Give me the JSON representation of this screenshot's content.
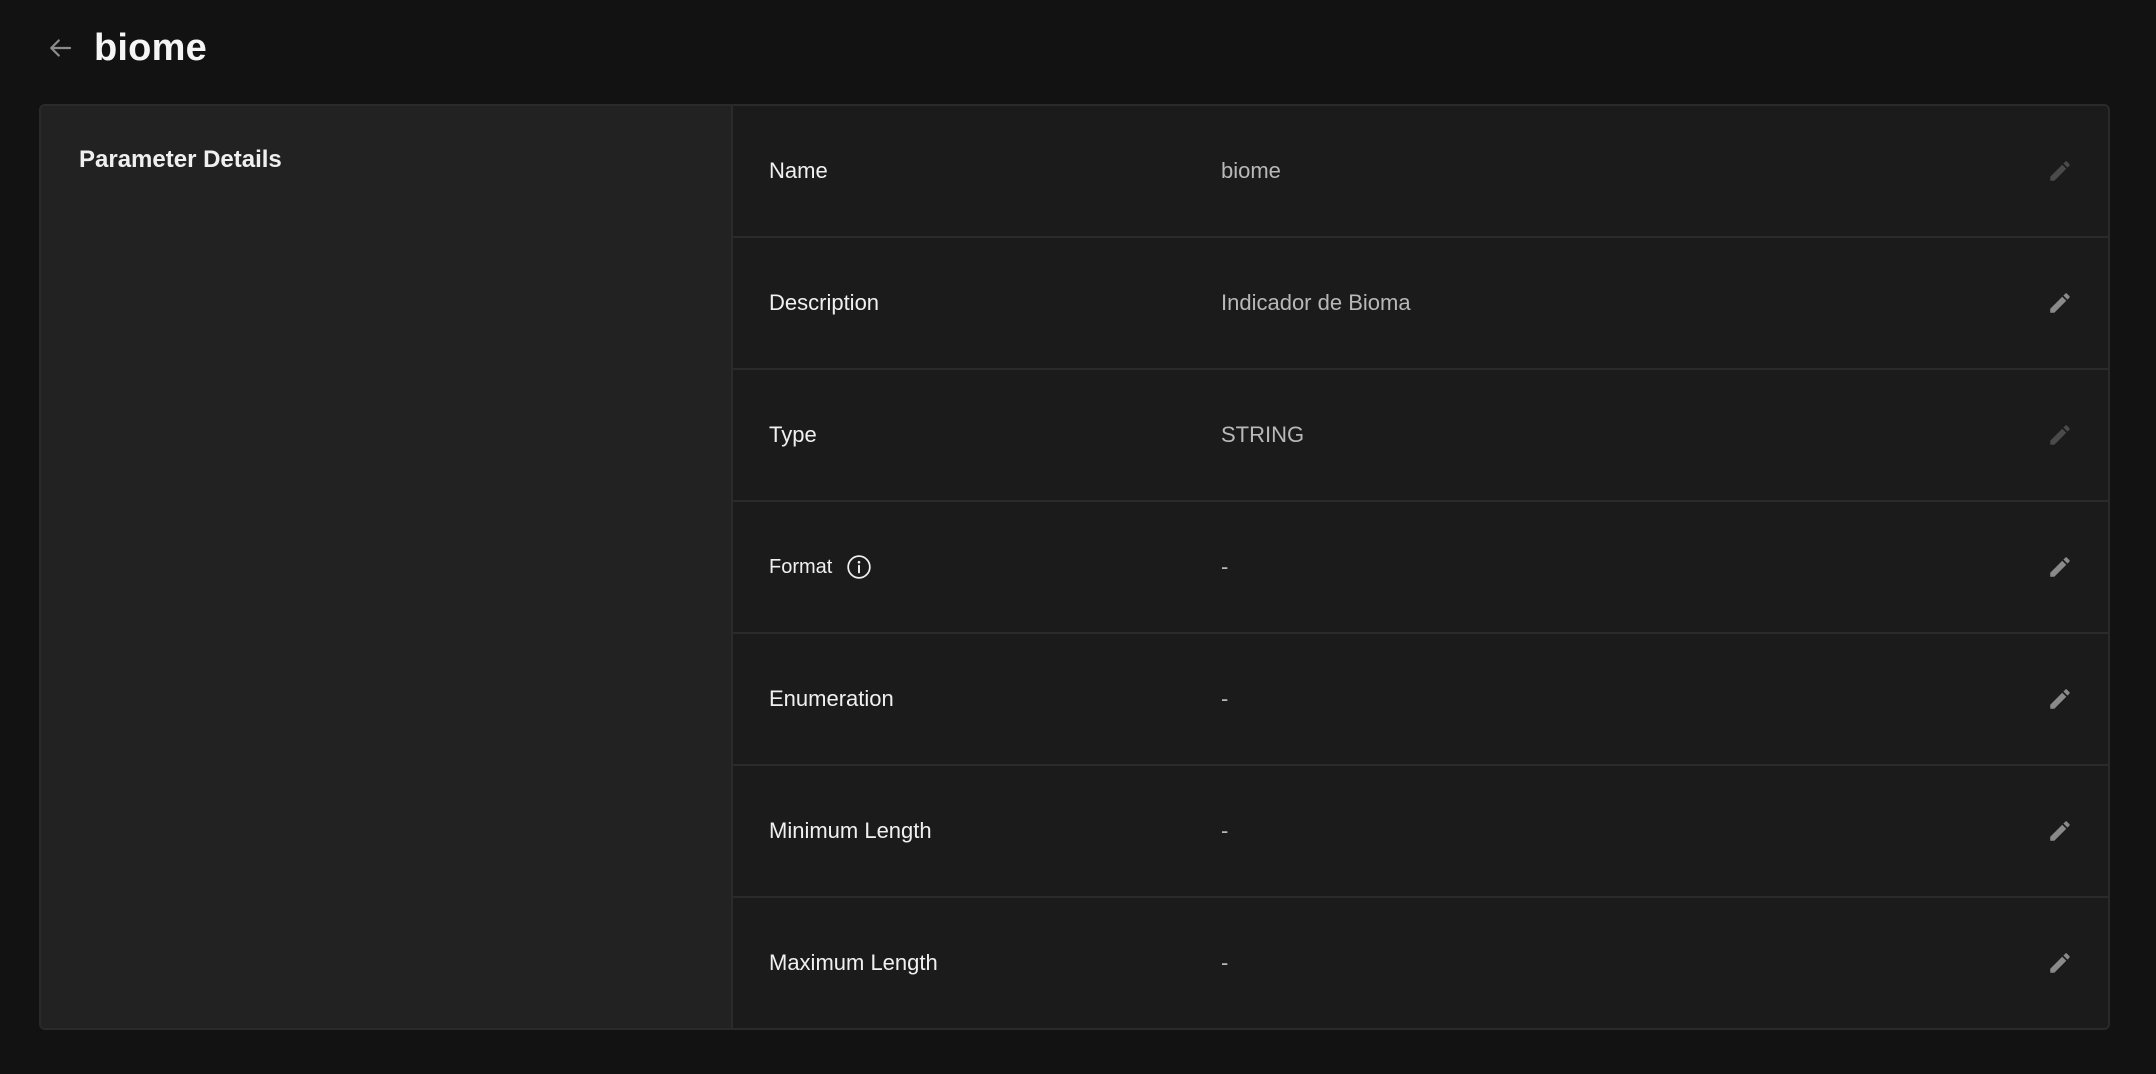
{
  "header": {
    "title": "biome",
    "back_icon": "arrow-left-icon"
  },
  "left_panel": {
    "section_title": "Parameter Details"
  },
  "fields": [
    {
      "label": "Name",
      "value": "biome",
      "editable": false
    },
    {
      "label": "Description",
      "value": "Indicador de Bioma",
      "editable": true
    },
    {
      "label": "Type",
      "value": "STRING",
      "editable": false
    },
    {
      "label": "Format",
      "value": "-",
      "editable": true,
      "info_icon": "info-icon"
    },
    {
      "label": "Enumeration",
      "value": "-",
      "editable": true
    },
    {
      "label": "Minimum Length",
      "value": "-",
      "editable": true
    },
    {
      "label": "Maximum Length",
      "value": "-",
      "editable": true
    }
  ],
  "colors": {
    "background": "#121212",
    "panel_left": "#222222",
    "panel_right": "#1b1b1b",
    "border": "#2b2b2b",
    "text_primary": "#f0f0f0",
    "text_secondary": "#b8b8b8",
    "icon_enabled": "#8a8a8a",
    "icon_disabled": "#4a4a4a"
  }
}
